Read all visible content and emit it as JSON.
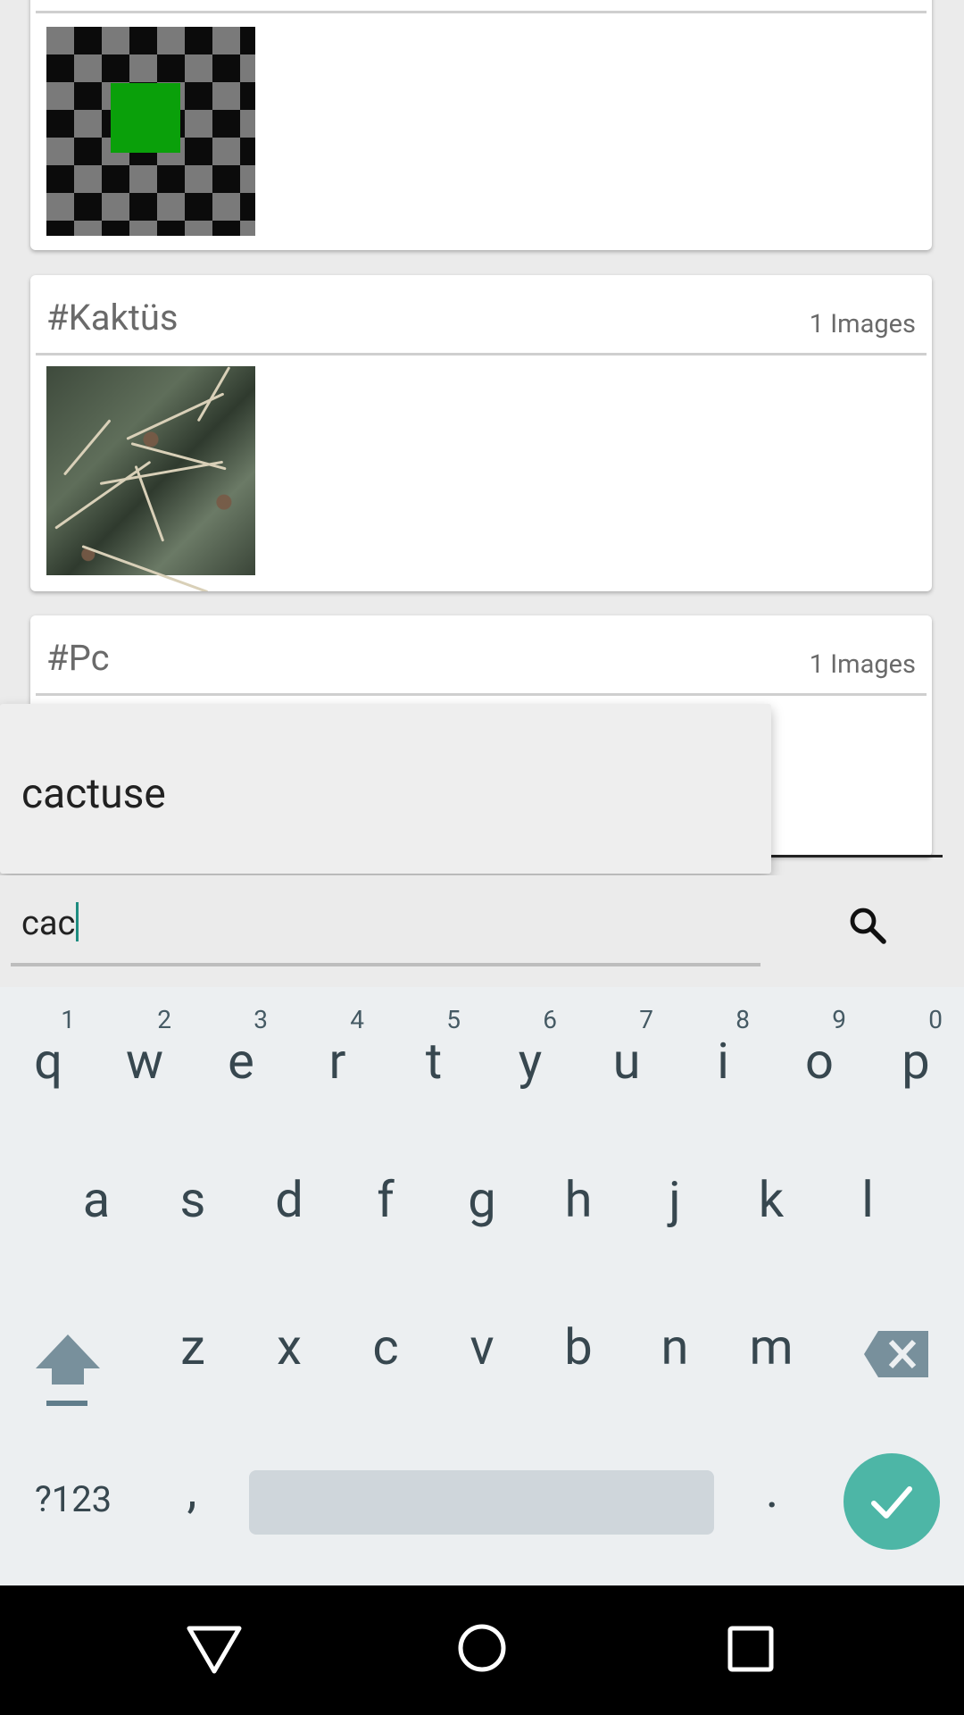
{
  "cards": [
    {
      "title": "",
      "count": "",
      "thumbnail": "checkerboard-image"
    },
    {
      "title": "#Kaktüs",
      "count": "1 Images",
      "thumbnail": "cactus-image"
    },
    {
      "title": "#Pc",
      "count": "1 Images",
      "thumbnail": ""
    }
  ],
  "suggestion": {
    "text": "cactuse"
  },
  "search": {
    "value": "cac",
    "icon": "search-icon"
  },
  "keyboard": {
    "row1": [
      {
        "ch": "q",
        "num": "1"
      },
      {
        "ch": "w",
        "num": "2"
      },
      {
        "ch": "e",
        "num": "3"
      },
      {
        "ch": "r",
        "num": "4"
      },
      {
        "ch": "t",
        "num": "5"
      },
      {
        "ch": "y",
        "num": "6"
      },
      {
        "ch": "u",
        "num": "7"
      },
      {
        "ch": "i",
        "num": "8"
      },
      {
        "ch": "o",
        "num": "9"
      },
      {
        "ch": "p",
        "num": "0"
      }
    ],
    "row2": [
      "a",
      "s",
      "d",
      "f",
      "g",
      "h",
      "j",
      "k",
      "l"
    ],
    "row3": [
      "z",
      "x",
      "c",
      "v",
      "b",
      "n",
      "m"
    ],
    "symbols_label": "?123",
    "comma": ",",
    "period": "."
  },
  "colors": {
    "accent": "#4db6a6",
    "keyboard_bg": "#eceff1",
    "card_bg": "#ffffff"
  }
}
